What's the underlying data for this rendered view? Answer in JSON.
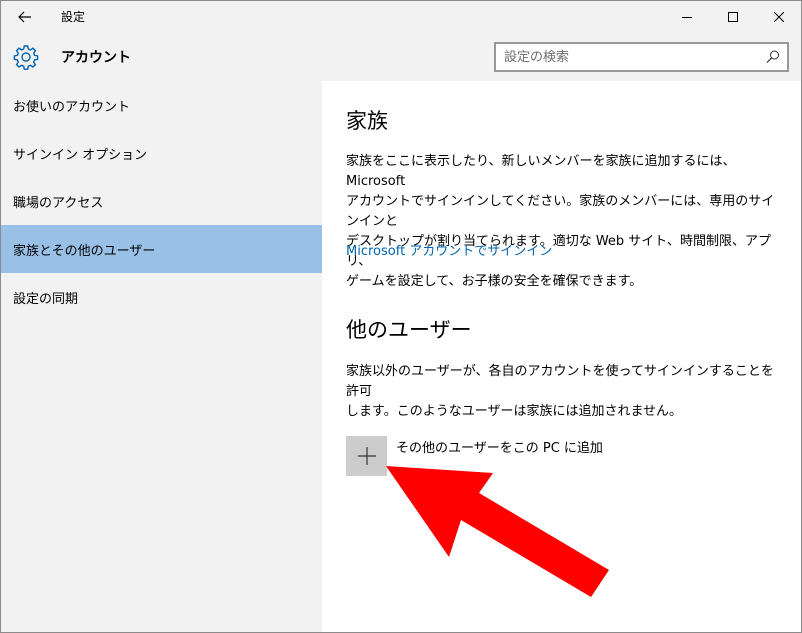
{
  "window": {
    "title": "設定"
  },
  "header": {
    "section_title": "アカウント",
    "search_placeholder": "設定の検索"
  },
  "sidebar": {
    "items": [
      {
        "label": "お使いのアカウント"
      },
      {
        "label": "サインイン オプション"
      },
      {
        "label": "職場のアクセス"
      },
      {
        "label": "家族とその他のユーザー"
      },
      {
        "label": "設定の同期"
      }
    ],
    "selected_index": 3
  },
  "main": {
    "family": {
      "heading": "家族",
      "description_lines": [
        "家族をここに表示したり、新しいメンバーを家族に追加するには、Microsoft",
        "アカウントでサインインしてください。家族のメンバーには、専用のサインインと",
        "デスクトップが割り当てられます。適切な Web サイト、時間制限、アプリ、",
        "ゲームを設定して、お子様の安全を確保できます。"
      ],
      "signin_link": "Microsoft アカウントでサインイン"
    },
    "other_users": {
      "heading": "他のユーザー",
      "description_lines": [
        "家族以外のユーザーが、各自のアカウントを使ってサインインすることを許可",
        "します。このようなユーザーは家族には追加されません。"
      ],
      "add_label": "その他のユーザーをこの PC に追加"
    }
  },
  "colors": {
    "accent": "#0063b1",
    "selected": "#99c1e8",
    "annotation_arrow": "#ff0000"
  }
}
